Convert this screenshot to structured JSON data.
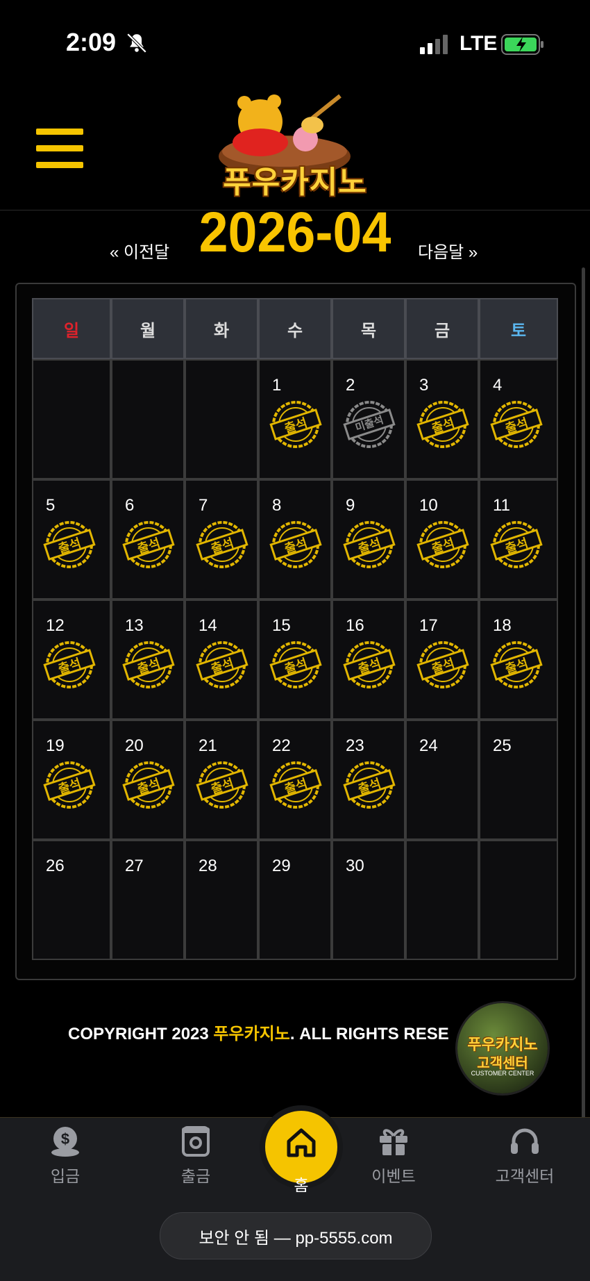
{
  "status_bar": {
    "time": "2:09",
    "network": "LTE"
  },
  "header": {
    "logo_text": "푸우카지노"
  },
  "calendar": {
    "month": "2026-04",
    "prev_label": "« 이전달",
    "next_label": "다음달 »",
    "weekdays": [
      "일",
      "월",
      "화",
      "수",
      "목",
      "금",
      "토"
    ],
    "weekday_colors": [
      "#e0222b",
      "#dddddd",
      "#dddddd",
      "#dddddd",
      "#dddddd",
      "#dddddd",
      "#5bb7f0"
    ],
    "weeks": [
      [
        {
          "d": ""
        },
        {
          "d": ""
        },
        {
          "d": ""
        },
        {
          "d": "1",
          "s": "출석"
        },
        {
          "d": "2",
          "s": "미출석"
        },
        {
          "d": "3",
          "s": "출석"
        },
        {
          "d": "4",
          "s": "출석"
        }
      ],
      [
        {
          "d": "5",
          "s": "출석"
        },
        {
          "d": "6",
          "s": "출석"
        },
        {
          "d": "7",
          "s": "출석"
        },
        {
          "d": "8",
          "s": "출석"
        },
        {
          "d": "9",
          "s": "출석"
        },
        {
          "d": "10",
          "s": "출석"
        },
        {
          "d": "11",
          "s": "출석"
        }
      ],
      [
        {
          "d": "12",
          "s": "출석"
        },
        {
          "d": "13",
          "s": "출석"
        },
        {
          "d": "14",
          "s": "출석"
        },
        {
          "d": "15",
          "s": "출석"
        },
        {
          "d": "16",
          "s": "출석"
        },
        {
          "d": "17",
          "s": "출석"
        },
        {
          "d": "18",
          "s": "출석"
        }
      ],
      [
        {
          "d": "19",
          "s": "출석"
        },
        {
          "d": "20",
          "s": "출석"
        },
        {
          "d": "21",
          "s": "출석"
        },
        {
          "d": "22",
          "s": "출석"
        },
        {
          "d": "23",
          "s": "출석"
        },
        {
          "d": "24"
        },
        {
          "d": "25"
        }
      ],
      [
        {
          "d": "26"
        },
        {
          "d": "27"
        },
        {
          "d": "28"
        },
        {
          "d": "29"
        },
        {
          "d": "30"
        },
        {
          "d": ""
        },
        {
          "d": ""
        }
      ]
    ],
    "colors": {
      "attended": "#e2b600",
      "absent": "#8a8a8a"
    }
  },
  "footer": {
    "copyright_prefix": "COPYRIGHT 2023 ",
    "copyright_brand": "푸우카지노",
    "copyright_suffix": ". ALL RIGHTS RESE",
    "cs_badge_title": "푸우카지노",
    "cs_badge_sub": "고객센터",
    "cs_badge_en": "CUSTOMER CENTER"
  },
  "bottom_nav": {
    "items": [
      {
        "label": "입금",
        "icon": "deposit-icon"
      },
      {
        "label": "출금",
        "icon": "withdraw-icon"
      },
      {
        "label": "홈",
        "icon": "home-icon"
      },
      {
        "label": "이벤트",
        "icon": "gift-icon"
      },
      {
        "label": "고객센터",
        "icon": "headset-icon"
      }
    ]
  },
  "browser": {
    "url_text": "보안 안 됨 — pp-5555.com"
  }
}
